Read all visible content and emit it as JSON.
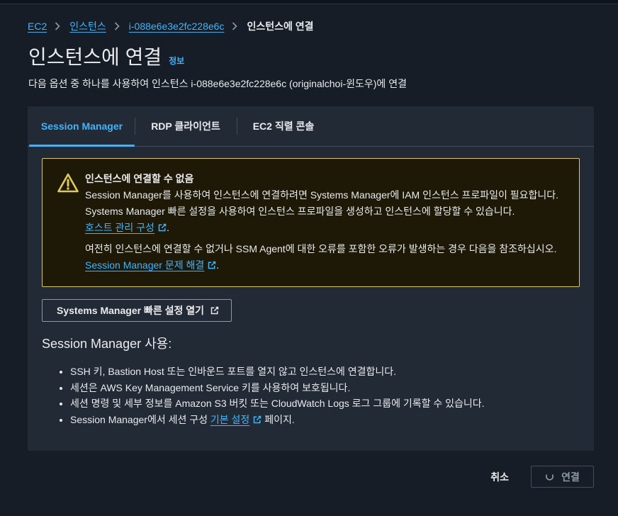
{
  "breadcrumb": [
    {
      "label": "EC2",
      "link": true
    },
    {
      "label": "인스턴스",
      "link": true
    },
    {
      "label": "i-088e6e3e2fc228e6c",
      "link": true
    },
    {
      "label": "인스턴스에 연결",
      "link": false
    }
  ],
  "page": {
    "title": "인스턴스에 연결",
    "info_link": "정보",
    "description": "다음 옵션 중 하나를 사용하여 인스턴스 i-088e6e3e2fc228e6c (originalchoi-윈도우)에 연결"
  },
  "tabs": [
    {
      "label": "Session Manager",
      "active": true
    },
    {
      "label": "RDP 클라이언트",
      "active": false
    },
    {
      "label": "EC2 직렬 콘솔",
      "active": false
    }
  ],
  "alert": {
    "icon": "warning-icon",
    "title": "인스턴스에 연결할 수 없음",
    "paragraph1": "Session Manager를 사용하여 인스턴스에 연결하려면 Systems Manager에 IAM 인스턴스 프로파일이 필요합니다. Systems Manager 빠른 설정을 사용하여 인스턴스 프로파일을 생성하고 인스턴스에 할당할 수 있습니다.",
    "paragraph1_link": "호스트 관리 구성",
    "paragraph1_end": ".",
    "paragraph2": "여전히 인스턴스에 연결할 수 없거나 SSM Agent에 대한 오류를 포함한 오류가 발생하는 경우 다음을 참조하십시오. ",
    "paragraph2_link": "Session Manager 문제 해결",
    "paragraph2_end": "."
  },
  "quick_setup_button": {
    "label": "Systems Manager 빠른 설정 열기",
    "icon": "external-link-icon"
  },
  "session_manager": {
    "heading": "Session Manager 사용:",
    "bullets": [
      "SSH 키, Bastion Host 또는 인바운드 포트를 열지 않고 인스턴스에 연결합니다.",
      "세션은 AWS Key Management Service 키를 사용하여 보호됩니다.",
      "세션 명령 및 세부 정보를 Amazon S3 버킷 또는 CloudWatch Logs 로그 그룹에 기록할 수 있습니다."
    ],
    "last_bullet": {
      "before": "Session Manager에서 세션 구성 ",
      "link": "기본 설정",
      "after": " 페이지."
    }
  },
  "footer": {
    "cancel": "취소",
    "connect": {
      "label": "연결",
      "disabled": true,
      "loading": true,
      "icon": "spinner-icon"
    }
  },
  "colors": {
    "page_bg": "#161d26",
    "card_bg": "#222a35",
    "link": "#42b4ff",
    "warning": "#e0ca57",
    "warning_bg": "#1d1906",
    "text": "#e9ebed",
    "muted": "#8d99a8",
    "border": "#414d5c",
    "button_border": "#8d99a8"
  }
}
